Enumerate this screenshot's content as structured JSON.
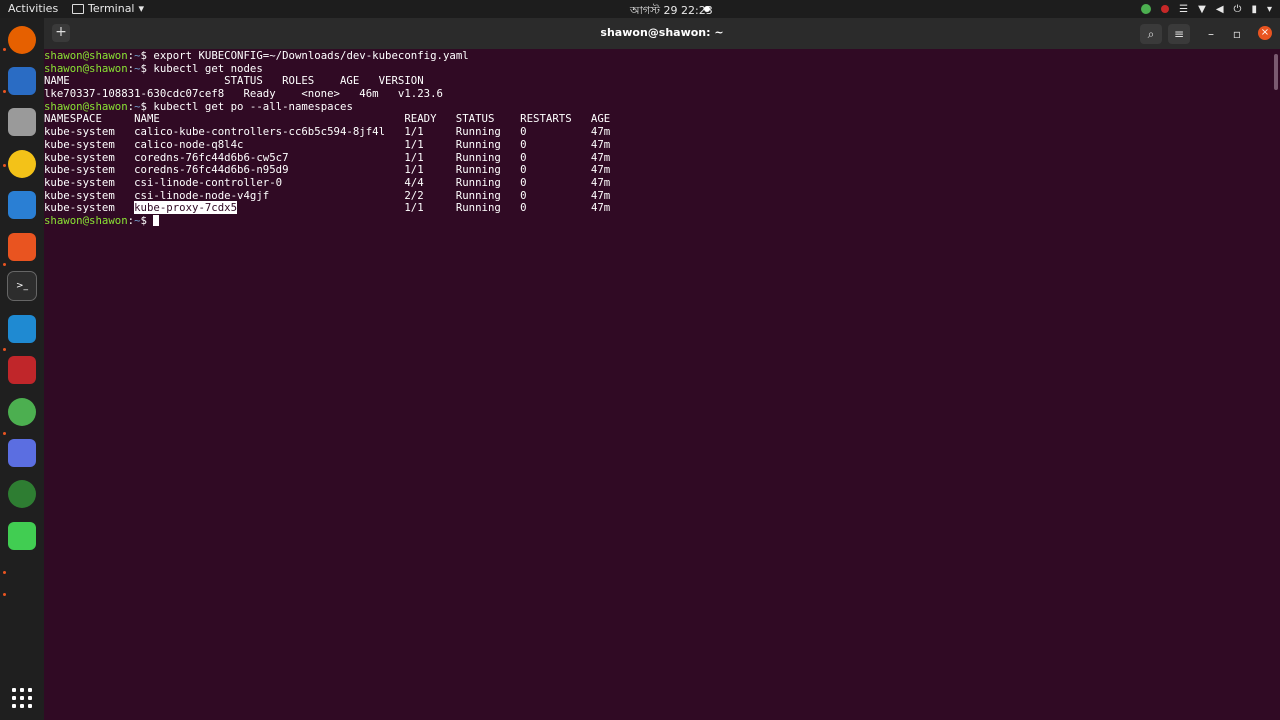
{
  "topbar": {
    "activities": "Activities",
    "app_name": "Terminal",
    "clock": "আগস্ট 29  22:23"
  },
  "dock": {
    "items": [
      {
        "name": "firefox-icon",
        "color": "#e66000"
      },
      {
        "name": "thunderbird-icon",
        "color": "#2a6cc4"
      },
      {
        "name": "files-icon",
        "color": "#9a9a9a"
      },
      {
        "name": "rhythmbox-icon",
        "color": "#f3c218"
      },
      {
        "name": "libreoffice-writer-icon",
        "color": "#2a7fd4"
      },
      {
        "name": "app-center-icon",
        "color": "#e95420"
      },
      {
        "name": "terminal-icon",
        "color": "#444444"
      },
      {
        "name": "vscode-icon",
        "color": "#1f8ad2"
      },
      {
        "name": "remote-desktop-icon",
        "color": "#c0262a"
      },
      {
        "name": "chrome-icon",
        "color": "#4caf50"
      },
      {
        "name": "screenshot-icon",
        "color": "#5b6ee1"
      },
      {
        "name": "globe-app-icon",
        "color": "#2e7d32"
      },
      {
        "name": "qt-creator-icon",
        "color": "#41cd52"
      }
    ]
  },
  "window": {
    "title": "shawon@shawon: ~"
  },
  "terminal": {
    "prompt_user": "shawon@shawon",
    "prompt_path": "~",
    "lines": [
      {
        "type": "cmd",
        "text": "export KUBECONFIG=~/Downloads/dev-kubeconfig.yaml"
      },
      {
        "type": "cmd",
        "text": "kubectl get nodes"
      },
      {
        "type": "out",
        "text": "NAME                        STATUS   ROLES    AGE   VERSION"
      },
      {
        "type": "out",
        "text": "lke70337-108831-630cdc07cef8   Ready    <none>   46m   v1.23.6"
      },
      {
        "type": "cmd",
        "text": "kubectl get po --all-namespaces"
      },
      {
        "type": "out",
        "text": "NAMESPACE     NAME                                      READY   STATUS    RESTARTS   AGE"
      },
      {
        "type": "out",
        "text": "kube-system   calico-kube-controllers-cc6b5c594-8jf4l   1/1     Running   0          47m"
      },
      {
        "type": "out",
        "text": "kube-system   calico-node-q8l4c                         1/1     Running   0          47m"
      },
      {
        "type": "out",
        "text": "kube-system   coredns-76fc44d6b6-cw5c7                  1/1     Running   0          47m"
      },
      {
        "type": "out",
        "text": "kube-system   coredns-76fc44d6b6-n95d9                  1/1     Running   0          47m"
      },
      {
        "type": "out",
        "text": "kube-system   csi-linode-controller-0                   4/4     Running   0          47m"
      },
      {
        "type": "out",
        "text": "kube-system   csi-linode-node-v4gjf                     2/2     Running   0          47m"
      }
    ],
    "last_row": {
      "prefix": "kube-system   ",
      "selected": "kube-proxy-7cdx5",
      "suffix": "                          1/1     Running   0          47m"
    }
  }
}
